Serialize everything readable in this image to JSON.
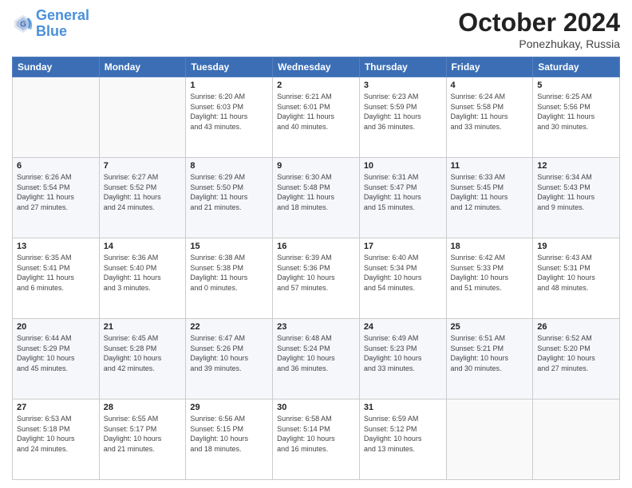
{
  "header": {
    "logo_line1": "General",
    "logo_line2": "Blue",
    "month_title": "October 2024",
    "subtitle": "Ponezhukay, Russia"
  },
  "days_of_week": [
    "Sunday",
    "Monday",
    "Tuesday",
    "Wednesday",
    "Thursday",
    "Friday",
    "Saturday"
  ],
  "weeks": [
    [
      {
        "day": "",
        "info": ""
      },
      {
        "day": "",
        "info": ""
      },
      {
        "day": "1",
        "info": "Sunrise: 6:20 AM\nSunset: 6:03 PM\nDaylight: 11 hours\nand 43 minutes."
      },
      {
        "day": "2",
        "info": "Sunrise: 6:21 AM\nSunset: 6:01 PM\nDaylight: 11 hours\nand 40 minutes."
      },
      {
        "day": "3",
        "info": "Sunrise: 6:23 AM\nSunset: 5:59 PM\nDaylight: 11 hours\nand 36 minutes."
      },
      {
        "day": "4",
        "info": "Sunrise: 6:24 AM\nSunset: 5:58 PM\nDaylight: 11 hours\nand 33 minutes."
      },
      {
        "day": "5",
        "info": "Sunrise: 6:25 AM\nSunset: 5:56 PM\nDaylight: 11 hours\nand 30 minutes."
      }
    ],
    [
      {
        "day": "6",
        "info": "Sunrise: 6:26 AM\nSunset: 5:54 PM\nDaylight: 11 hours\nand 27 minutes."
      },
      {
        "day": "7",
        "info": "Sunrise: 6:27 AM\nSunset: 5:52 PM\nDaylight: 11 hours\nand 24 minutes."
      },
      {
        "day": "8",
        "info": "Sunrise: 6:29 AM\nSunset: 5:50 PM\nDaylight: 11 hours\nand 21 minutes."
      },
      {
        "day": "9",
        "info": "Sunrise: 6:30 AM\nSunset: 5:48 PM\nDaylight: 11 hours\nand 18 minutes."
      },
      {
        "day": "10",
        "info": "Sunrise: 6:31 AM\nSunset: 5:47 PM\nDaylight: 11 hours\nand 15 minutes."
      },
      {
        "day": "11",
        "info": "Sunrise: 6:33 AM\nSunset: 5:45 PM\nDaylight: 11 hours\nand 12 minutes."
      },
      {
        "day": "12",
        "info": "Sunrise: 6:34 AM\nSunset: 5:43 PM\nDaylight: 11 hours\nand 9 minutes."
      }
    ],
    [
      {
        "day": "13",
        "info": "Sunrise: 6:35 AM\nSunset: 5:41 PM\nDaylight: 11 hours\nand 6 minutes."
      },
      {
        "day": "14",
        "info": "Sunrise: 6:36 AM\nSunset: 5:40 PM\nDaylight: 11 hours\nand 3 minutes."
      },
      {
        "day": "15",
        "info": "Sunrise: 6:38 AM\nSunset: 5:38 PM\nDaylight: 11 hours\nand 0 minutes."
      },
      {
        "day": "16",
        "info": "Sunrise: 6:39 AM\nSunset: 5:36 PM\nDaylight: 10 hours\nand 57 minutes."
      },
      {
        "day": "17",
        "info": "Sunrise: 6:40 AM\nSunset: 5:34 PM\nDaylight: 10 hours\nand 54 minutes."
      },
      {
        "day": "18",
        "info": "Sunrise: 6:42 AM\nSunset: 5:33 PM\nDaylight: 10 hours\nand 51 minutes."
      },
      {
        "day": "19",
        "info": "Sunrise: 6:43 AM\nSunset: 5:31 PM\nDaylight: 10 hours\nand 48 minutes."
      }
    ],
    [
      {
        "day": "20",
        "info": "Sunrise: 6:44 AM\nSunset: 5:29 PM\nDaylight: 10 hours\nand 45 minutes."
      },
      {
        "day": "21",
        "info": "Sunrise: 6:45 AM\nSunset: 5:28 PM\nDaylight: 10 hours\nand 42 minutes."
      },
      {
        "day": "22",
        "info": "Sunrise: 6:47 AM\nSunset: 5:26 PM\nDaylight: 10 hours\nand 39 minutes."
      },
      {
        "day": "23",
        "info": "Sunrise: 6:48 AM\nSunset: 5:24 PM\nDaylight: 10 hours\nand 36 minutes."
      },
      {
        "day": "24",
        "info": "Sunrise: 6:49 AM\nSunset: 5:23 PM\nDaylight: 10 hours\nand 33 minutes."
      },
      {
        "day": "25",
        "info": "Sunrise: 6:51 AM\nSunset: 5:21 PM\nDaylight: 10 hours\nand 30 minutes."
      },
      {
        "day": "26",
        "info": "Sunrise: 6:52 AM\nSunset: 5:20 PM\nDaylight: 10 hours\nand 27 minutes."
      }
    ],
    [
      {
        "day": "27",
        "info": "Sunrise: 6:53 AM\nSunset: 5:18 PM\nDaylight: 10 hours\nand 24 minutes."
      },
      {
        "day": "28",
        "info": "Sunrise: 6:55 AM\nSunset: 5:17 PM\nDaylight: 10 hours\nand 21 minutes."
      },
      {
        "day": "29",
        "info": "Sunrise: 6:56 AM\nSunset: 5:15 PM\nDaylight: 10 hours\nand 18 minutes."
      },
      {
        "day": "30",
        "info": "Sunrise: 6:58 AM\nSunset: 5:14 PM\nDaylight: 10 hours\nand 16 minutes."
      },
      {
        "day": "31",
        "info": "Sunrise: 6:59 AM\nSunset: 5:12 PM\nDaylight: 10 hours\nand 13 minutes."
      },
      {
        "day": "",
        "info": ""
      },
      {
        "day": "",
        "info": ""
      }
    ]
  ]
}
